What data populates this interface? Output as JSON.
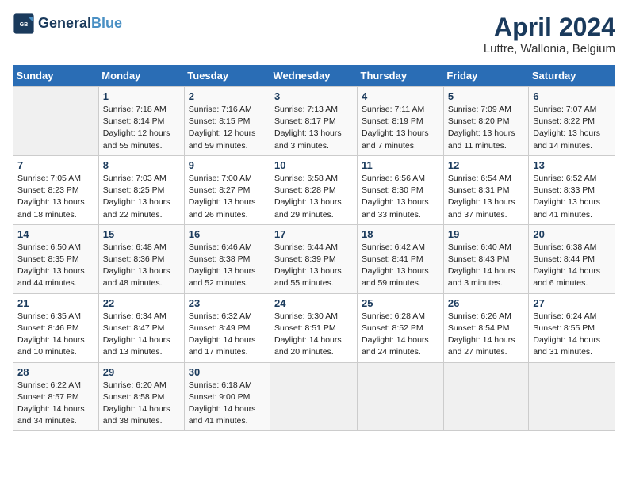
{
  "header": {
    "logo_line1": "General",
    "logo_line2": "Blue",
    "title": "April 2024",
    "subtitle": "Luttre, Wallonia, Belgium"
  },
  "weekdays": [
    "Sunday",
    "Monday",
    "Tuesday",
    "Wednesday",
    "Thursday",
    "Friday",
    "Saturday"
  ],
  "weeks": [
    [
      {
        "day": "",
        "empty": true
      },
      {
        "day": "1",
        "sunrise": "7:18 AM",
        "sunset": "8:14 PM",
        "daylight": "12 hours and 55 minutes."
      },
      {
        "day": "2",
        "sunrise": "7:16 AM",
        "sunset": "8:15 PM",
        "daylight": "12 hours and 59 minutes."
      },
      {
        "day": "3",
        "sunrise": "7:13 AM",
        "sunset": "8:17 PM",
        "daylight": "13 hours and 3 minutes."
      },
      {
        "day": "4",
        "sunrise": "7:11 AM",
        "sunset": "8:19 PM",
        "daylight": "13 hours and 7 minutes."
      },
      {
        "day": "5",
        "sunrise": "7:09 AM",
        "sunset": "8:20 PM",
        "daylight": "13 hours and 11 minutes."
      },
      {
        "day": "6",
        "sunrise": "7:07 AM",
        "sunset": "8:22 PM",
        "daylight": "13 hours and 14 minutes."
      }
    ],
    [
      {
        "day": "7",
        "sunrise": "7:05 AM",
        "sunset": "8:23 PM",
        "daylight": "13 hours and 18 minutes."
      },
      {
        "day": "8",
        "sunrise": "7:03 AM",
        "sunset": "8:25 PM",
        "daylight": "13 hours and 22 minutes."
      },
      {
        "day": "9",
        "sunrise": "7:00 AM",
        "sunset": "8:27 PM",
        "daylight": "13 hours and 26 minutes."
      },
      {
        "day": "10",
        "sunrise": "6:58 AM",
        "sunset": "8:28 PM",
        "daylight": "13 hours and 29 minutes."
      },
      {
        "day": "11",
        "sunrise": "6:56 AM",
        "sunset": "8:30 PM",
        "daylight": "13 hours and 33 minutes."
      },
      {
        "day": "12",
        "sunrise": "6:54 AM",
        "sunset": "8:31 PM",
        "daylight": "13 hours and 37 minutes."
      },
      {
        "day": "13",
        "sunrise": "6:52 AM",
        "sunset": "8:33 PM",
        "daylight": "13 hours and 41 minutes."
      }
    ],
    [
      {
        "day": "14",
        "sunrise": "6:50 AM",
        "sunset": "8:35 PM",
        "daylight": "13 hours and 44 minutes."
      },
      {
        "day": "15",
        "sunrise": "6:48 AM",
        "sunset": "8:36 PM",
        "daylight": "13 hours and 48 minutes."
      },
      {
        "day": "16",
        "sunrise": "6:46 AM",
        "sunset": "8:38 PM",
        "daylight": "13 hours and 52 minutes."
      },
      {
        "day": "17",
        "sunrise": "6:44 AM",
        "sunset": "8:39 PM",
        "daylight": "13 hours and 55 minutes."
      },
      {
        "day": "18",
        "sunrise": "6:42 AM",
        "sunset": "8:41 PM",
        "daylight": "13 hours and 59 minutes."
      },
      {
        "day": "19",
        "sunrise": "6:40 AM",
        "sunset": "8:43 PM",
        "daylight": "14 hours and 3 minutes."
      },
      {
        "day": "20",
        "sunrise": "6:38 AM",
        "sunset": "8:44 PM",
        "daylight": "14 hours and 6 minutes."
      }
    ],
    [
      {
        "day": "21",
        "sunrise": "6:35 AM",
        "sunset": "8:46 PM",
        "daylight": "14 hours and 10 minutes."
      },
      {
        "day": "22",
        "sunrise": "6:34 AM",
        "sunset": "8:47 PM",
        "daylight": "14 hours and 13 minutes."
      },
      {
        "day": "23",
        "sunrise": "6:32 AM",
        "sunset": "8:49 PM",
        "daylight": "14 hours and 17 minutes."
      },
      {
        "day": "24",
        "sunrise": "6:30 AM",
        "sunset": "8:51 PM",
        "daylight": "14 hours and 20 minutes."
      },
      {
        "day": "25",
        "sunrise": "6:28 AM",
        "sunset": "8:52 PM",
        "daylight": "14 hours and 24 minutes."
      },
      {
        "day": "26",
        "sunrise": "6:26 AM",
        "sunset": "8:54 PM",
        "daylight": "14 hours and 27 minutes."
      },
      {
        "day": "27",
        "sunrise": "6:24 AM",
        "sunset": "8:55 PM",
        "daylight": "14 hours and 31 minutes."
      }
    ],
    [
      {
        "day": "28",
        "sunrise": "6:22 AM",
        "sunset": "8:57 PM",
        "daylight": "14 hours and 34 minutes."
      },
      {
        "day": "29",
        "sunrise": "6:20 AM",
        "sunset": "8:58 PM",
        "daylight": "14 hours and 38 minutes."
      },
      {
        "day": "30",
        "sunrise": "6:18 AM",
        "sunset": "9:00 PM",
        "daylight": "14 hours and 41 minutes."
      },
      {
        "day": "",
        "empty": true
      },
      {
        "day": "",
        "empty": true
      },
      {
        "day": "",
        "empty": true
      },
      {
        "day": "",
        "empty": true
      }
    ]
  ]
}
